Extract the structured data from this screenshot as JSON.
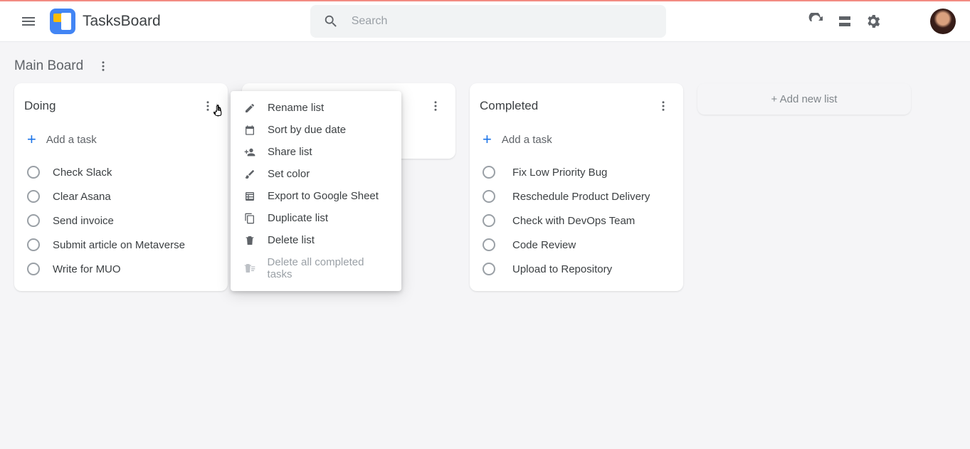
{
  "header": {
    "brand": "TasksBoard",
    "search_placeholder": "Search"
  },
  "board": {
    "title": "Main Board",
    "add_list_label": "+ Add new list"
  },
  "columns": [
    {
      "title": "Doing",
      "add_task_label": "Add a task",
      "tasks": [
        {
          "label": "Check Slack"
        },
        {
          "label": "Clear Asana"
        },
        {
          "label": "Send invoice"
        },
        {
          "label": "Submit article on Metaverse"
        },
        {
          "label": "Write for MUO"
        }
      ]
    },
    {
      "title": "",
      "add_task_label": "",
      "tasks": []
    },
    {
      "title": "Completed",
      "add_task_label": "Add a task",
      "tasks": [
        {
          "label": "Fix Low Priority Bug"
        },
        {
          "label": "Reschedule Product Delivery"
        },
        {
          "label": "Check with DevOps Team"
        },
        {
          "label": "Code Review"
        },
        {
          "label": "Upload to Repository"
        }
      ]
    }
  ],
  "menu": {
    "items": [
      {
        "label": "Rename list",
        "icon": "pencil-icon"
      },
      {
        "label": "Sort by due date",
        "icon": "calendar-icon"
      },
      {
        "label": "Share list",
        "icon": "person-add-icon"
      },
      {
        "label": "Set color",
        "icon": "brush-icon"
      },
      {
        "label": "Export to Google Sheet",
        "icon": "sheet-icon"
      },
      {
        "label": "Duplicate list",
        "icon": "copy-icon"
      },
      {
        "label": "Delete list",
        "icon": "trash-icon"
      },
      {
        "label": "Delete all completed tasks",
        "icon": "sweep-icon",
        "disabled": true
      }
    ]
  }
}
